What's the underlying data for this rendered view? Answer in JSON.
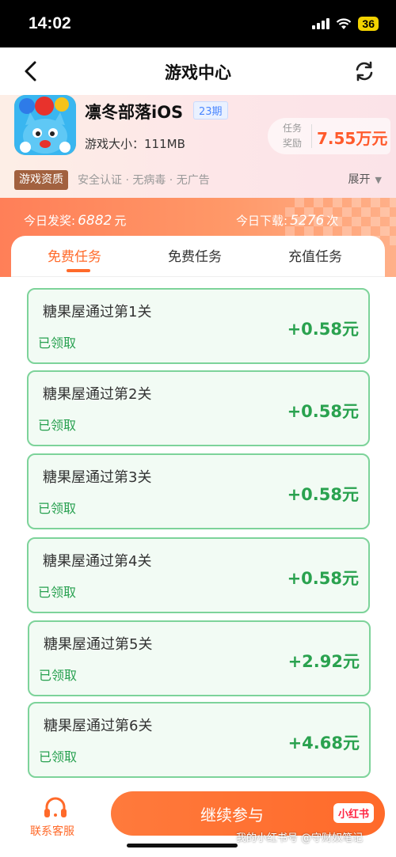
{
  "status_bar": {
    "time": "14:02",
    "battery": "36"
  },
  "nav": {
    "title": "游戏中心"
  },
  "game": {
    "name": "凛冬部落iOS",
    "period": "23期",
    "size": "游戏大小：111MB",
    "reward_label": "任务奖励",
    "reward_value": "7.55万元",
    "qualification_tag": "游戏资质",
    "qualification_text": "安全认证 · 无病毒 · 无广告",
    "expand_label": "展开"
  },
  "stats": {
    "today_awards_label": "今日发奖:",
    "today_awards_value": "6882",
    "today_awards_unit": "元",
    "today_downloads_label": "今日下载:",
    "today_downloads_value": "5276",
    "today_downloads_unit": "次"
  },
  "tabs": [
    {
      "label": "免费任务",
      "active": true
    },
    {
      "label": "免费任务",
      "active": false
    },
    {
      "label": "充值任务",
      "active": false
    }
  ],
  "tasks": [
    {
      "title": "糖果屋通过第1关",
      "status": "已领取",
      "reward": "+0.58元"
    },
    {
      "title": "糖果屋通过第2关",
      "status": "已领取",
      "reward": "+0.58元"
    },
    {
      "title": "糖果屋通过第3关",
      "status": "已领取",
      "reward": "+0.58元"
    },
    {
      "title": "糖果屋通过第4关",
      "status": "已领取",
      "reward": "+0.58元"
    },
    {
      "title": "糖果屋通过第5关",
      "status": "已领取",
      "reward": "+2.92元"
    },
    {
      "title": "糖果屋通过第6关",
      "status": "已领取",
      "reward": "+4.68元"
    }
  ],
  "bottom": {
    "customer_service": "联系客服",
    "continue": "继续参与",
    "badge": "小红书",
    "watermark": "我的小红书号 @守财奴笔记"
  },
  "colors": {
    "accent": "#ff6a2a",
    "success": "#2aa24f",
    "task_border": "#7dd39a"
  },
  "icons": [
    "back-arrow-icon",
    "refresh-icon",
    "game-app-icon",
    "caret-down-icon",
    "headset-icon"
  ]
}
